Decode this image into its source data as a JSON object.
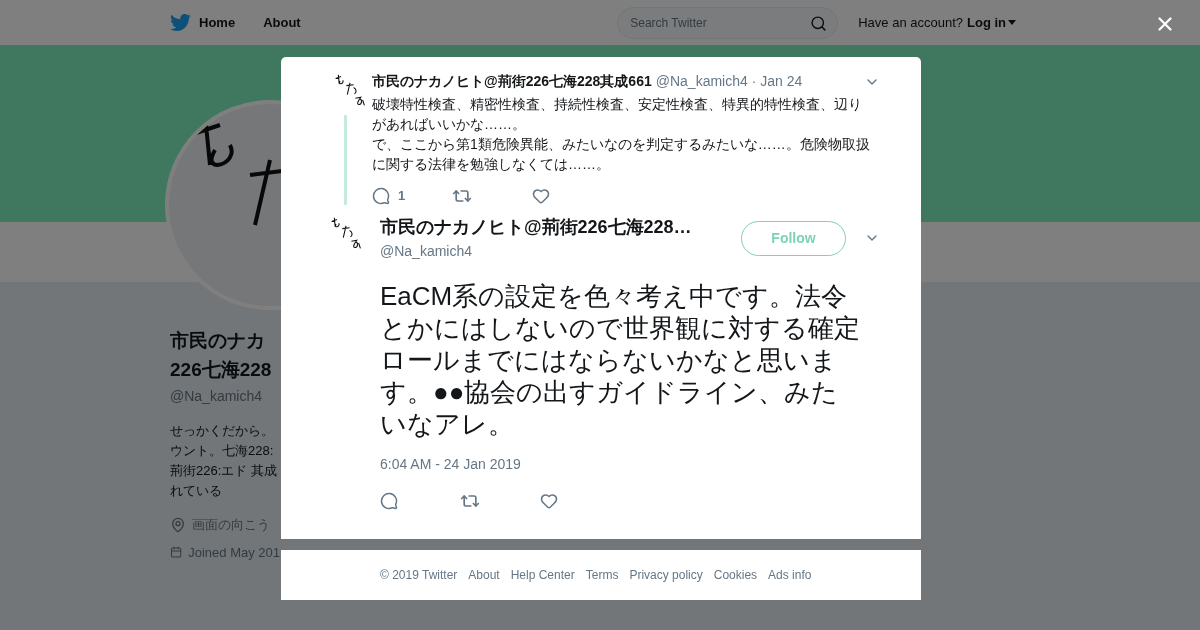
{
  "header": {
    "nav": [
      "Home",
      "About"
    ],
    "search": {
      "placeholder": "Search Twitter"
    },
    "account_prompt": "Have an account?",
    "login": "Log in"
  },
  "profile": {
    "name_lines": [
      "市民のナカ",
      "226七海228"
    ],
    "handle": "@Na_kamich4",
    "bio_lines": [
      "せっかくだから。",
      "ウント。七海228:",
      "荊街226:エド 其成",
      "れている"
    ],
    "location": "画面の向こう",
    "joined": "Joined May 201"
  },
  "parent_tweet": {
    "name": "市民のナカノヒト@荊街226七海228其成661",
    "handle": "@Na_kamich4",
    "date": "· Jan 24",
    "paragraphs": [
      "破壊特性検査、精密性検査、持続性検査、安定性検査、特異的特性検査、辺りがあればいいかな……。",
      "で、ここから第1類危険異能、みたいなのを判定するみたいな……。危険物取扱に関する法律を勉強しなくては……。"
    ],
    "reply_count": "1"
  },
  "main_tweet": {
    "name": "市民のナカノヒト@荊街226七海228…",
    "handle": "@Na_kamich4",
    "follow": "Follow",
    "text": "EaCM系の設定を色々考え中です。法令とかにはしないので世界観に対する確定ロールまでにはならないかなと思います。●●協会の出すガイドライン、みたいなアレ。",
    "timestamp": "6:04 AM - 24 Jan 2019"
  },
  "footer": [
    "© 2019 Twitter",
    "About",
    "Help Center",
    "Terms",
    "Privacy policy",
    "Cookies",
    "Ads info"
  ]
}
